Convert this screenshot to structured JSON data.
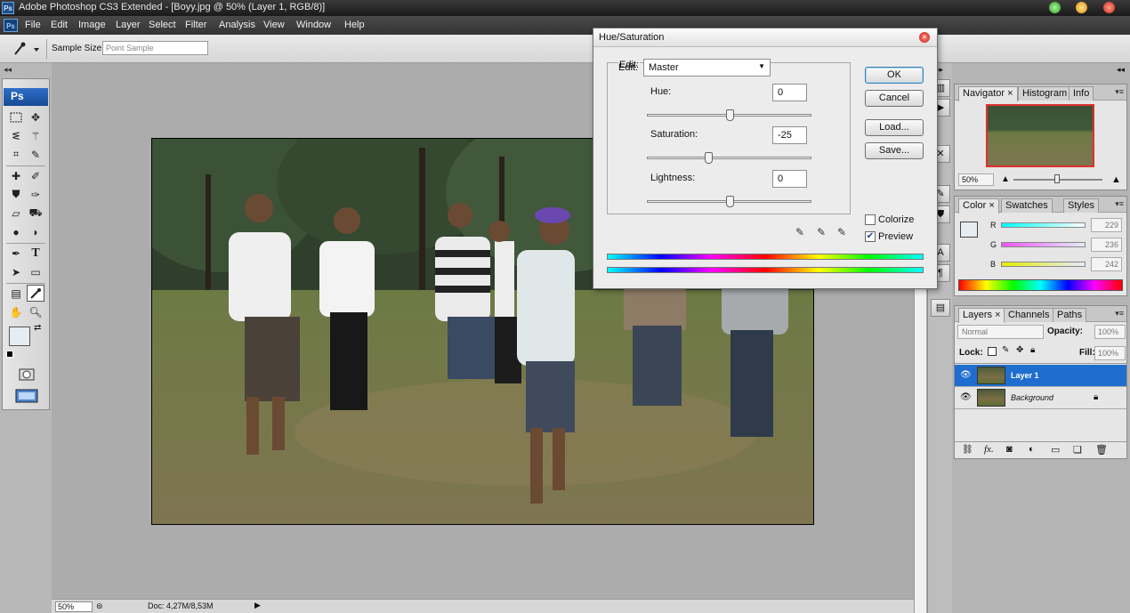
{
  "titlebar": {
    "app_badge": "Ps",
    "title": "Adobe Photoshop CS3 Extended - [Boyy.jpg @ 50% (Layer 1, RGB/8)]",
    "window_buttons": [
      "minimize",
      "restore",
      "close"
    ]
  },
  "menubar": {
    "app_icon": "Ps",
    "items": [
      "File",
      "Edit",
      "Image",
      "Layer",
      "Select",
      "Filter",
      "Analysis",
      "View",
      "Window",
      "Help"
    ]
  },
  "options_bar": {
    "sample_size_label": "Sample Size:",
    "sample_size_value": "Point Sample"
  },
  "toolbox": {
    "header": "Ps",
    "active_tool": "eyedropper"
  },
  "status_bar": {
    "zoom": "50%",
    "doc_info": "Doc: 4,27M/8,53M"
  },
  "dialog": {
    "title": "Hue/Saturation",
    "edit_label": "Edit:",
    "edit_value": "Master",
    "hue_label": "Hue:",
    "hue_value": "0",
    "hue_level": 0,
    "saturation_label": "Saturation:",
    "saturation_value": "-25",
    "saturation_level": -25,
    "lightness_label": "Lightness:",
    "lightness_value": "0",
    "lightness_level": 0,
    "ok_label": "OK",
    "cancel_label": "Cancel",
    "load_label": "Load...",
    "save_label": "Save...",
    "colorize_label": "Colorize",
    "colorize_checked": false,
    "preview_label": "Preview",
    "preview_checked": true
  },
  "navigator_panel": {
    "tabs": [
      "Navigator",
      "Histogram",
      "Info"
    ],
    "zoom": "50%"
  },
  "color_panel": {
    "tabs": [
      "Color",
      "Swatches",
      "Styles"
    ],
    "r_label": "R",
    "g_label": "G",
    "b_label": "B",
    "r_value": "229",
    "g_value": "236",
    "b_value": "242",
    "foreground_color": "#e5ecf2"
  },
  "layers_panel": {
    "tabs": [
      "Layers",
      "Channels",
      "Paths"
    ],
    "blend_mode": "Normal",
    "opacity_label": "Opacity:",
    "opacity_value": "100%",
    "lock_label": "Lock:",
    "fill_label": "Fill:",
    "fill_value": "100%",
    "layers": [
      {
        "name": "Layer 1",
        "selected": true,
        "locked": false
      },
      {
        "name": "Background",
        "selected": false,
        "locked": true
      }
    ],
    "footer_icons": [
      "link-icon",
      "fx-icon",
      "mask-icon",
      "adjustment-icon",
      "folder-icon",
      "new-layer-icon",
      "trash-icon"
    ]
  },
  "colors": {
    "selection_blue": "#1f6ecf",
    "title_bar": "#1a1a1a",
    "canvas_bg": "#acacac"
  }
}
